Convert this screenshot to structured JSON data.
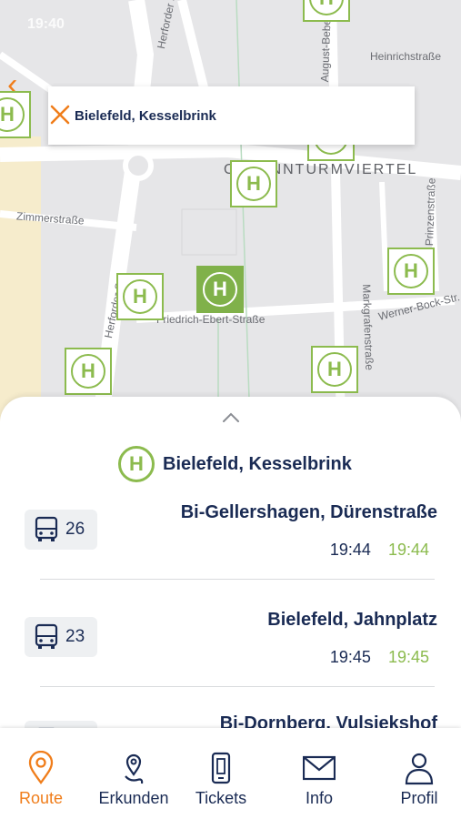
{
  "status_bar": {
    "time": "19:40"
  },
  "search": {
    "label": "Bielefeld, Kesselbrink"
  },
  "map": {
    "streets": [
      "Herforder Str.",
      "Zimmerstraße",
      "Herforder Str.",
      "Friedrich-Ebert-Straße",
      "August-Bebel",
      "Heinrichstraße",
      "Markgrafenstraße",
      "Prinzenstraße",
      "Werner-Bock-Str."
    ],
    "district": "OLDANNTURMVIERTEL",
    "stop_letter": "H"
  },
  "sheet": {
    "stop_name": "Bielefeld, Kesselbrink",
    "stop_letter": "H",
    "departures": [
      {
        "line": "26",
        "destination": "Bi-Gellershagen, Dürenstraße",
        "scheduled": "19:44",
        "realtime": "19:44"
      },
      {
        "line": "23",
        "destination": "Bielefeld, Jahnplatz",
        "scheduled": "19:45",
        "realtime": "19:45"
      },
      {
        "line": "",
        "destination": "Bi-Dornberg, Vulsiekshof",
        "scheduled": "",
        "realtime": ""
      }
    ]
  },
  "tabs": [
    {
      "label": "Route",
      "icon": "location-pin-icon",
      "active": true
    },
    {
      "label": "Erkunden",
      "icon": "explore-icon",
      "active": false
    },
    {
      "label": "Tickets",
      "icon": "ticket-phone-icon",
      "active": false
    },
    {
      "label": "Info",
      "icon": "envelope-icon",
      "active": false
    },
    {
      "label": "Profil",
      "icon": "person-icon",
      "active": false
    }
  ],
  "colors": {
    "accent": "#f07d1a",
    "stop_green": "#8cbb4e",
    "navy": "#1a2b54"
  }
}
